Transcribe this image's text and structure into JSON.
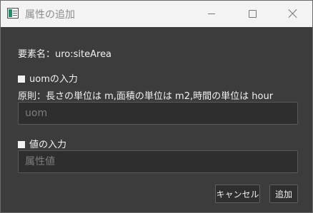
{
  "window": {
    "title": "属性の追加",
    "app_icon": "window-icon"
  },
  "titlebar": {
    "minimize_icon": "minimize-icon",
    "maximize_icon": "maximize-icon",
    "close_icon": "close-icon"
  },
  "form": {
    "element_name": "要素名：uro:siteArea",
    "uom": {
      "checkbox_state": "checked",
      "label": "uomの入力",
      "rule": "原則：長さの単位は m,面積の単位は m2,時間の単位は hour",
      "value": "",
      "placeholder": "uom"
    },
    "value": {
      "checkbox_state": "checked",
      "label": "値の入力",
      "value": "",
      "placeholder": "属性値"
    }
  },
  "buttons": {
    "cancel": "キャンセル",
    "add": "追加"
  }
}
